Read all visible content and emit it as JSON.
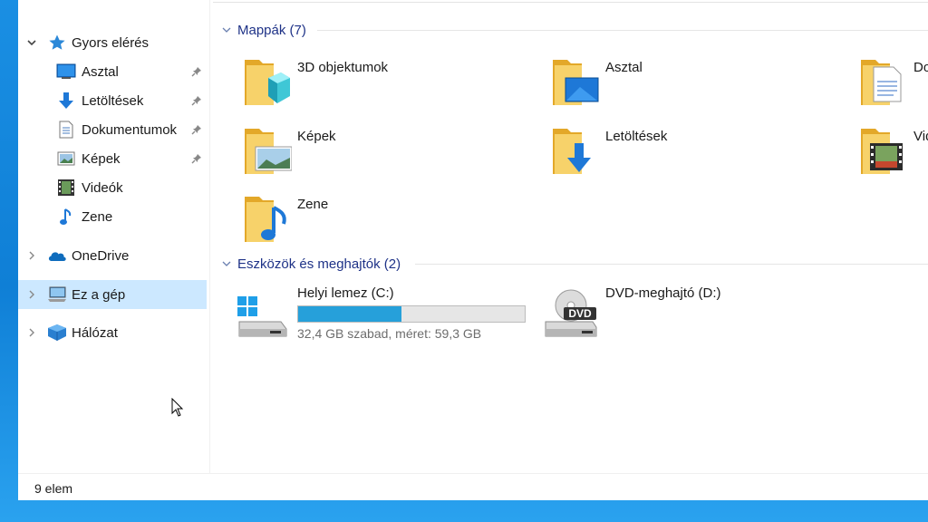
{
  "sidebar": {
    "quick_access": {
      "label": "Gyors elérés",
      "icon": "star-icon"
    },
    "quick_items": [
      {
        "label": "Asztal",
        "icon": "desktop-icon",
        "pinned": true
      },
      {
        "label": "Letöltések",
        "icon": "download-icon",
        "pinned": true
      },
      {
        "label": "Dokumentumok",
        "icon": "document-icon",
        "pinned": true
      },
      {
        "label": "Képek",
        "icon": "pictures-icon",
        "pinned": true
      },
      {
        "label": "Videók",
        "icon": "video-icon",
        "pinned": false
      },
      {
        "label": "Zene",
        "icon": "music-icon",
        "pinned": false
      }
    ],
    "onedrive": {
      "label": "OneDrive",
      "icon": "cloud-icon"
    },
    "this_pc": {
      "label": "Ez a gép",
      "icon": "computer-icon",
      "selected": true
    },
    "network": {
      "label": "Hálózat",
      "icon": "network-icon"
    }
  },
  "content": {
    "folders_header": "Mappák (7)",
    "folders": [
      {
        "label": "3D objektumok",
        "icon": "3d-objects-folder-icon"
      },
      {
        "label": "Asztal",
        "icon": "desktop-folder-icon"
      },
      {
        "label": "Do",
        "icon": "documents-folder-icon"
      },
      {
        "label": "Képek",
        "icon": "pictures-folder-icon"
      },
      {
        "label": "Letöltések",
        "icon": "downloads-folder-icon"
      },
      {
        "label": "Vid",
        "icon": "videos-folder-icon"
      },
      {
        "label": "Zene",
        "icon": "music-folder-icon"
      }
    ],
    "drives_header": "Eszközök és meghajtók (2)",
    "drives": [
      {
        "name": "Helyi lemez (C:)",
        "sub": "32,4 GB szabad, méret: 59,3 GB",
        "used_fraction": 0.454,
        "icon": "windows-drive-icon"
      },
      {
        "name": "DVD-meghajtó (D:)",
        "icon": "dvd-drive-icon",
        "dvd_text": "DVD"
      }
    ]
  },
  "status": {
    "count": "9 elem"
  },
  "colors": {
    "selected": "#cce8ff",
    "header": "#1e3287",
    "bar": "#26a0da",
    "folder": "#f5c94a"
  }
}
